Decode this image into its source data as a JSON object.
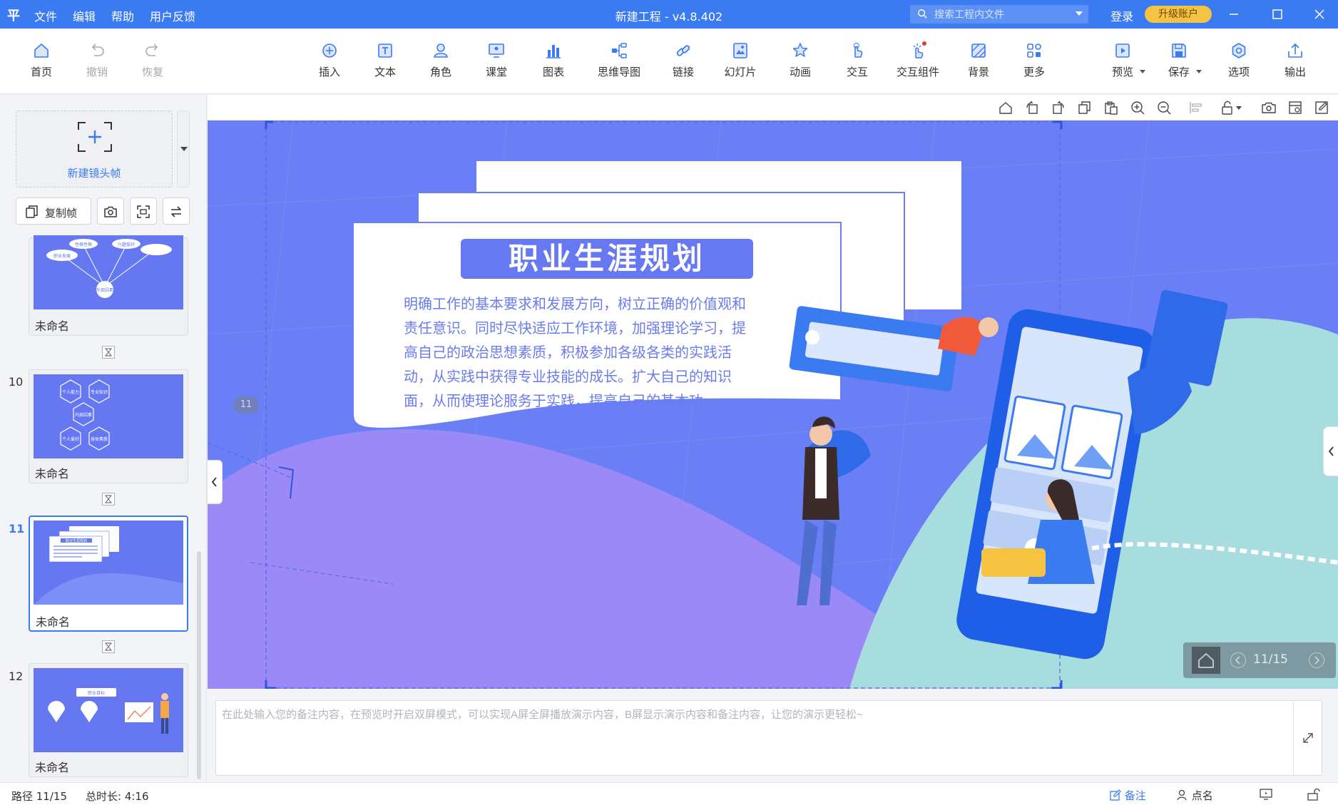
{
  "app": {
    "logo": "平",
    "menu": [
      "文件",
      "编辑",
      "帮助",
      "用户反馈"
    ],
    "title": "新建工程 - v4.8.402",
    "search_placeholder": "搜索工程内文件",
    "login": "登录",
    "upgrade": "升级账户"
  },
  "toolbar": {
    "home": "首页",
    "undo": "撤销",
    "redo": "恢复",
    "insert": "插入",
    "text": "文本",
    "role": "角色",
    "class": "课堂",
    "chart": "图表",
    "mindmap": "思维导图",
    "link": "链接",
    "slide": "幻灯片",
    "animation": "动画",
    "interaction": "交互",
    "interaction_widget": "交互组件",
    "background": "背景",
    "more": "更多",
    "preview": "预览",
    "save": "保存",
    "options": "选项",
    "export": "输出"
  },
  "left": {
    "new_frame": "新建镜头帧",
    "copy_frame": "复制帧",
    "slides": [
      {
        "num": "",
        "name": "未命名",
        "preview": [
          "职业发展",
          "性格性格",
          "兴趣爱好",
          "外部因素"
        ]
      },
      {
        "num": "10",
        "name": "未命名",
        "preview": [
          "个人能力",
          "专业知识",
          "内部因素",
          "个人爱好",
          "身体素质"
        ]
      },
      {
        "num": "11",
        "name": "未命名",
        "preview": [
          "职业生涯规划"
        ]
      },
      {
        "num": "12",
        "name": "未命名",
        "preview": [
          "职业目标"
        ]
      }
    ]
  },
  "slide": {
    "badge": "11",
    "title": "职业生涯规划",
    "body": "明确工作的基本要求和发展方向，树立正确的价值观和责任意识。同时尽快适应工作环境，加强理论学习，提高自己的政治思想素质，积极参加各级各类的实践活动，从实践中获得专业技能的成长。扩大自己的知识面，从而使理论服务于实践，提高自己的基本功。",
    "counter": "11/15"
  },
  "notes": {
    "placeholder": "在此处输入您的备注内容，在预览时开启双屏模式，可以实现A屏全屏播放演示内容，B屏显示演示内容和备注内容，让您的演示更轻松~"
  },
  "status": {
    "path": "路径 11/15",
    "duration": "总时长: 4:16",
    "notes": "备注",
    "rollcall": "点名"
  },
  "colors": {
    "accent": "#3a7bf2",
    "slide_bg": "#6a7ef5",
    "upgrade": "#f5c242",
    "teal": "#a6dcdf"
  }
}
